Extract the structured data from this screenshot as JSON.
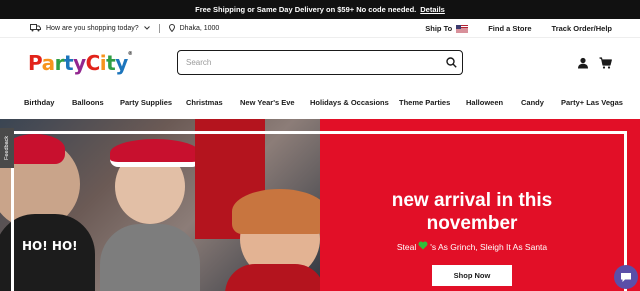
{
  "promo": {
    "text": "Free Shipping or Same Day Delivery on $59+ No code needed.",
    "link": "Details"
  },
  "utility": {
    "delivery_question": "How are you shopping today?",
    "location": "Dhaka, 1000",
    "ship_to": "Ship To",
    "find_store": "Find a Store",
    "track_order": "Track Order/Help"
  },
  "logo": {
    "word1": "Party",
    "word2": "City",
    "colors": [
      "#e2231a",
      "#f7941d",
      "#2f9e44",
      "#1c75bc",
      "#92278f"
    ]
  },
  "search": {
    "placeholder": "Search",
    "value": ""
  },
  "nav": {
    "items": [
      "Birthday",
      "Balloons",
      "Party Supplies",
      "Christmas",
      "New Year's Eve",
      "Holidays & Occasions",
      "Theme Parties",
      "Halloween",
      "Candy",
      "Party+ Las Vegas"
    ]
  },
  "hero": {
    "title_line1": "new arrival in this",
    "title_line2": "november",
    "subtitle_before": "Steal",
    "subtitle_after": "'s As Grinch, Sleigh It As Santa",
    "cta": "Shop Now",
    "photo_text": "HO! HO!",
    "background": "#e20f27"
  },
  "feedback": {
    "label": "Feedback"
  },
  "icons": {
    "delivery": "truck-icon",
    "location": "location-pin-icon",
    "flag": "us-flag-icon",
    "search": "search-icon",
    "account": "account-icon",
    "cart": "cart-icon",
    "chat": "chat-icon",
    "heart": "heart-icon"
  }
}
